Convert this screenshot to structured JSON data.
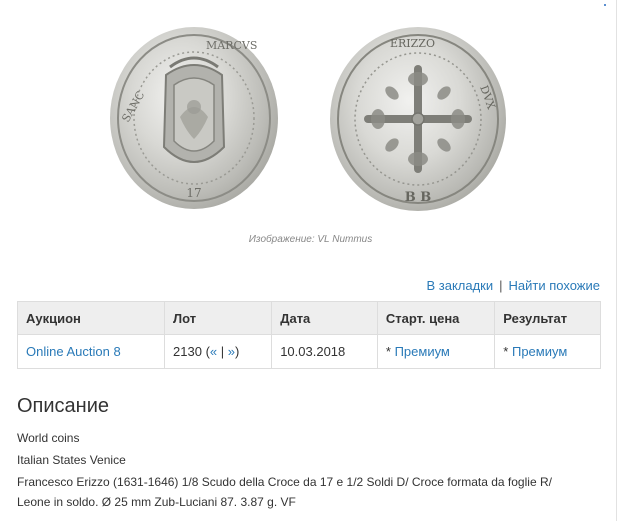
{
  "coin_images": {
    "obverse_legend": "SANC.TVS MARCVS VENET",
    "obverse_date": "17",
    "reverse_legend": "FRANC ERIZZO DVX VE",
    "reverse_mintmark": "B B",
    "metal_color": "#c4c4c0"
  },
  "caption": "Изображение: VL Nummus",
  "actions": {
    "bookmark": "В закладки",
    "separator": "|",
    "similar": "Найти похожие"
  },
  "table": {
    "headers": [
      "Аукцион",
      "Лот",
      "Дата",
      "Старт. цена",
      "Результат"
    ],
    "row": {
      "auction": "Online Auction 8",
      "lot_number": "2130",
      "lot_open": "(",
      "lot_prev": "«",
      "lot_sep": "|",
      "lot_next": "»",
      "lot_close": ")",
      "date": "10.03.2018",
      "start_price_prefix": "*",
      "start_price_link": "Премиум",
      "result_prefix": "*",
      "result_link": "Премиум"
    }
  },
  "description": {
    "heading": "Описание",
    "lines": [
      "World coins",
      "Italian States Venice",
      "Francesco Erizzo (1631-1646) 1/8 Scudo della Croce da 17 e 1/2 Soldi D/ Croce formata da foglie R/",
      "Leone in soldo. Ø 25 mm Zub-Luciani 87. 3.87 g. VF"
    ]
  },
  "colors": {
    "link": "#2a7ab8",
    "header_bg": "#eeeeee",
    "border": "#dddddd"
  }
}
